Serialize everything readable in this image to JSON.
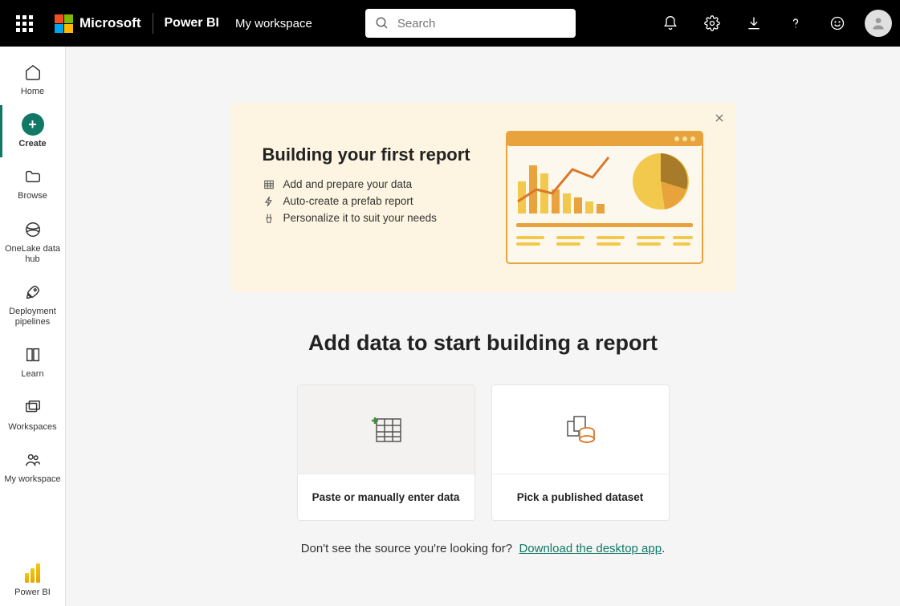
{
  "header": {
    "brand": "Microsoft",
    "product": "Power BI",
    "workspace": "My workspace",
    "search_placeholder": "Search"
  },
  "sidebar": {
    "items": [
      {
        "label": "Home"
      },
      {
        "label": "Create"
      },
      {
        "label": "Browse"
      },
      {
        "label": "OneLake data hub"
      },
      {
        "label": "Deployment pipelines"
      },
      {
        "label": "Learn"
      },
      {
        "label": "Workspaces"
      },
      {
        "label": "My workspace"
      }
    ],
    "footer": {
      "label": "Power BI"
    }
  },
  "banner": {
    "title": "Building your first report",
    "steps": [
      "Add and prepare your data",
      "Auto-create a prefab report",
      "Personalize it to suit your needs"
    ]
  },
  "main": {
    "heading": "Add data to start building a report",
    "cards": [
      {
        "label": "Paste or manually enter data"
      },
      {
        "label": "Pick a published dataset"
      }
    ],
    "footer_prompt": "Don't see the source you're looking for?",
    "footer_link": "Download the desktop app",
    "footer_period": "."
  }
}
